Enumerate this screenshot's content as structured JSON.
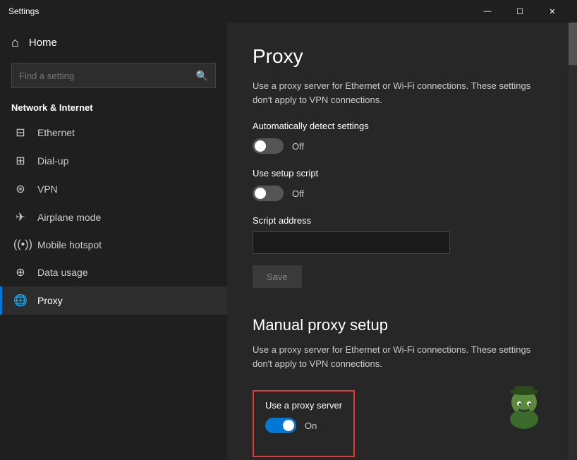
{
  "titlebar": {
    "title": "Settings",
    "minimize": "—",
    "maximize": "☐",
    "close": "✕"
  },
  "sidebar": {
    "home_label": "Home",
    "search_placeholder": "Find a setting",
    "section_label": "Network & Internet",
    "items": [
      {
        "id": "ethernet",
        "label": "Ethernet",
        "icon": "🖧"
      },
      {
        "id": "dialup",
        "label": "Dial-up",
        "icon": "📞"
      },
      {
        "id": "vpn",
        "label": "VPN",
        "icon": "🔒"
      },
      {
        "id": "airplane",
        "label": "Airplane mode",
        "icon": "✈"
      },
      {
        "id": "hotspot",
        "label": "Mobile hotspot",
        "icon": "📶"
      },
      {
        "id": "datausage",
        "label": "Data usage",
        "icon": "⊕"
      },
      {
        "id": "proxy",
        "label": "Proxy",
        "icon": "🌐"
      }
    ]
  },
  "content": {
    "page_title": "Proxy",
    "auto_proxy_desc": "Use a proxy server for Ethernet or Wi-Fi connections. These settings don't apply to VPN connections.",
    "auto_detect_label": "Automatically detect settings",
    "auto_detect_state": "Off",
    "auto_detect_on": false,
    "setup_script_label": "Use setup script",
    "setup_script_state": "Off",
    "setup_script_on": false,
    "script_address_label": "Script address",
    "script_address_value": "",
    "save_button_label": "Save",
    "manual_proxy_title": "Manual proxy setup",
    "manual_proxy_desc": "Use a proxy server for Ethernet or Wi-Fi connections. These settings don't apply to VPN connections.",
    "use_proxy_label": "Use a proxy server",
    "use_proxy_state": "On",
    "use_proxy_on": true
  }
}
